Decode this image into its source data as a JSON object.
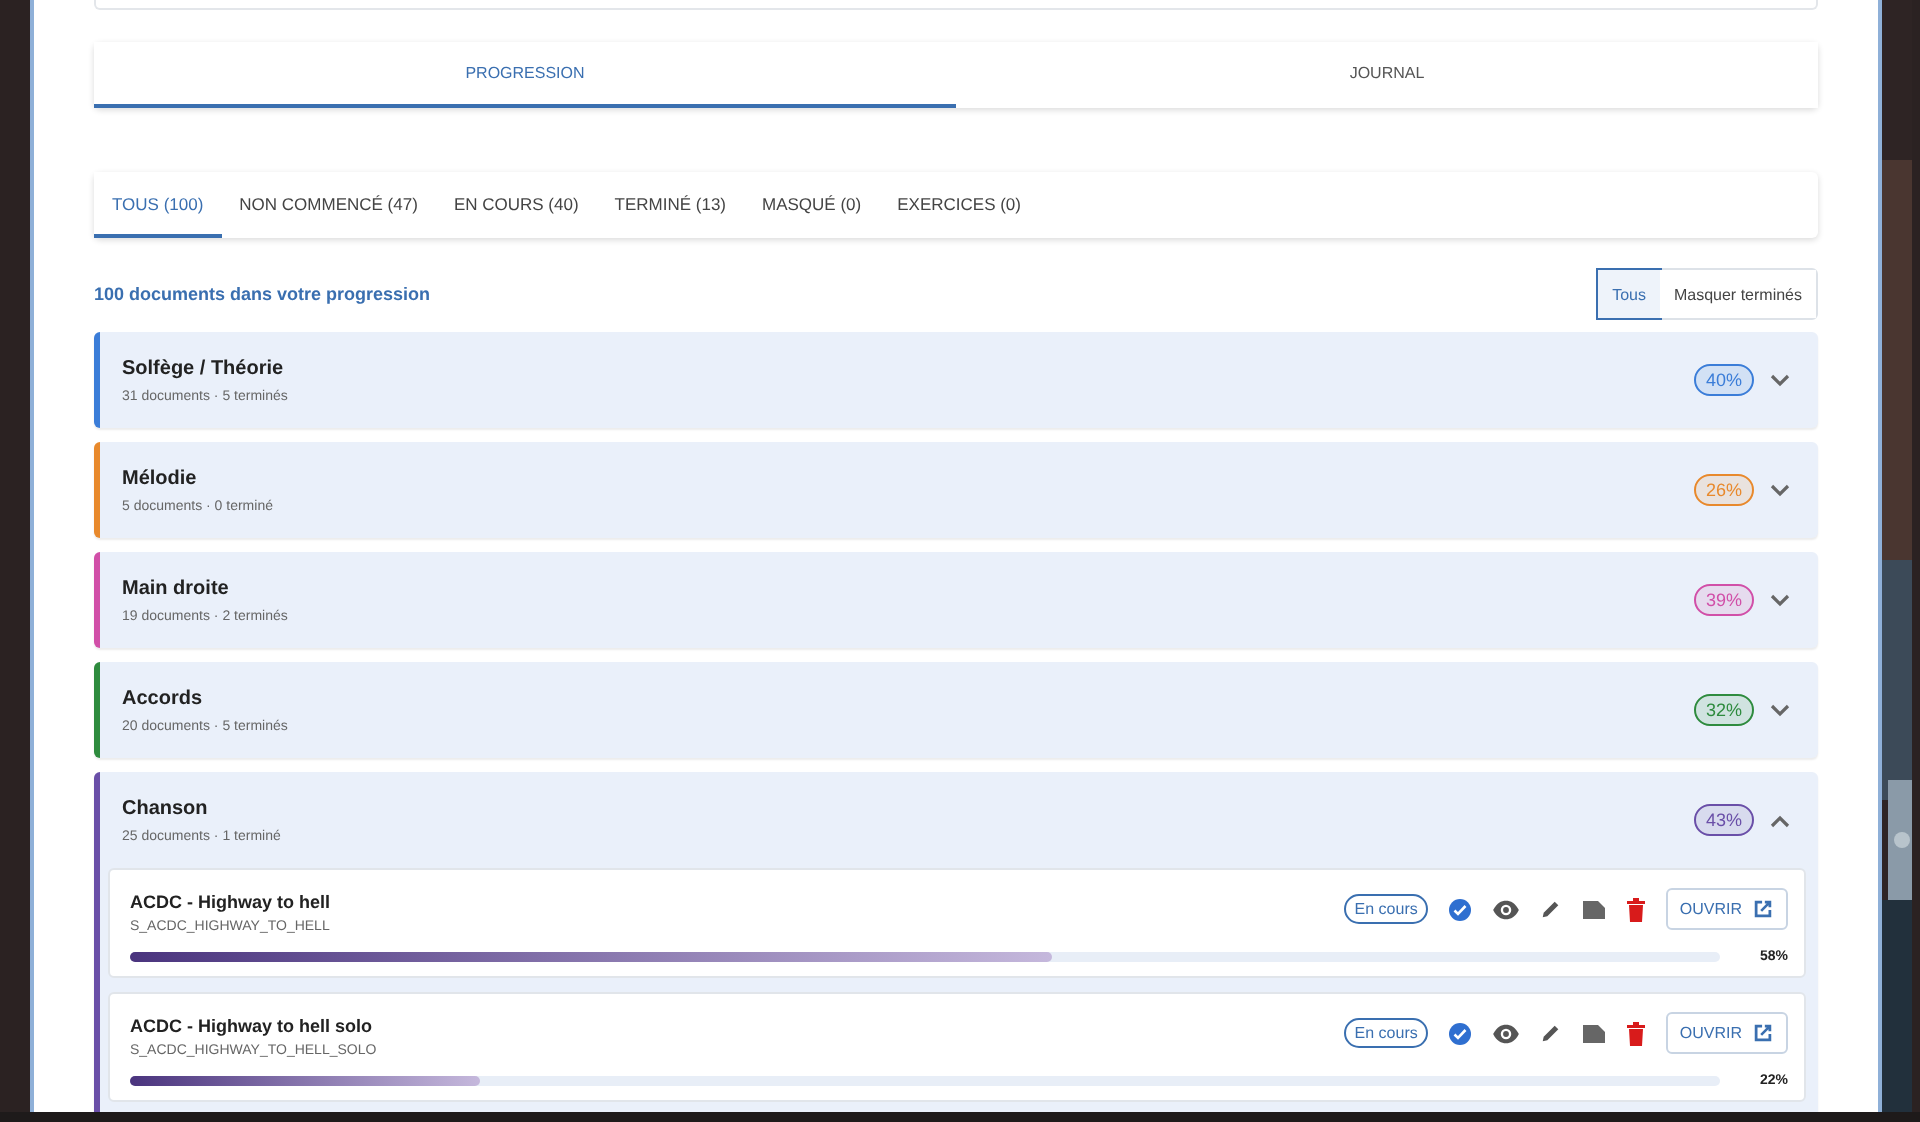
{
  "main_tabs": [
    {
      "label": "PROGRESSION",
      "selected": true
    },
    {
      "label": "JOURNAL",
      "selected": false
    }
  ],
  "filter_tabs": [
    {
      "label": "TOUS (100)",
      "selected": true
    },
    {
      "label": "NON COMMENCÉ (47)",
      "selected": false
    },
    {
      "label": "EN COURS (40)",
      "selected": false
    },
    {
      "label": "TERMINÉ (13)",
      "selected": false
    },
    {
      "label": "MASQUÉ (0)",
      "selected": false
    },
    {
      "label": "EXERCICES (0)",
      "selected": false
    }
  ],
  "summary": "100 documents dans votre progression",
  "view_toggle": [
    {
      "label": "Tous",
      "selected": true
    },
    {
      "label": "Masquer terminés",
      "selected": false
    }
  ],
  "categories": [
    {
      "title": "Solfège / Théorie",
      "subtitle": "31 documents · 5 terminés",
      "percent": "40%",
      "color": "#3b7dd8",
      "expanded": false
    },
    {
      "title": "Mélodie",
      "subtitle": "5 documents · 0 terminé",
      "percent": "26%",
      "color": "#e8892c",
      "expanded": false
    },
    {
      "title": "Main droite",
      "subtitle": "19 documents · 2 terminés",
      "percent": "39%",
      "color": "#d14fa8",
      "expanded": false
    },
    {
      "title": "Accords",
      "subtitle": "20 documents · 5 terminés",
      "percent": "32%",
      "color": "#2e8b3e",
      "expanded": false
    },
    {
      "title": "Chanson",
      "subtitle": "25 documents · 1 terminé",
      "percent": "43%",
      "color": "#6a4fa8",
      "expanded": true,
      "documents": [
        {
          "title": "ACDC - Highway to hell",
          "code": "S_ACDC_HIGHWAY_TO_HELL",
          "status": "En cours",
          "button": "OUVRIR",
          "level": 0.58,
          "percent": "58%"
        },
        {
          "title": "ACDC - Highway to hell solo",
          "code": "S_ACDC_HIGHWAY_TO_HELL_SOLO",
          "status": "En cours",
          "button": "OUVRIR",
          "level": 0.22,
          "percent": "22%"
        }
      ]
    }
  ]
}
